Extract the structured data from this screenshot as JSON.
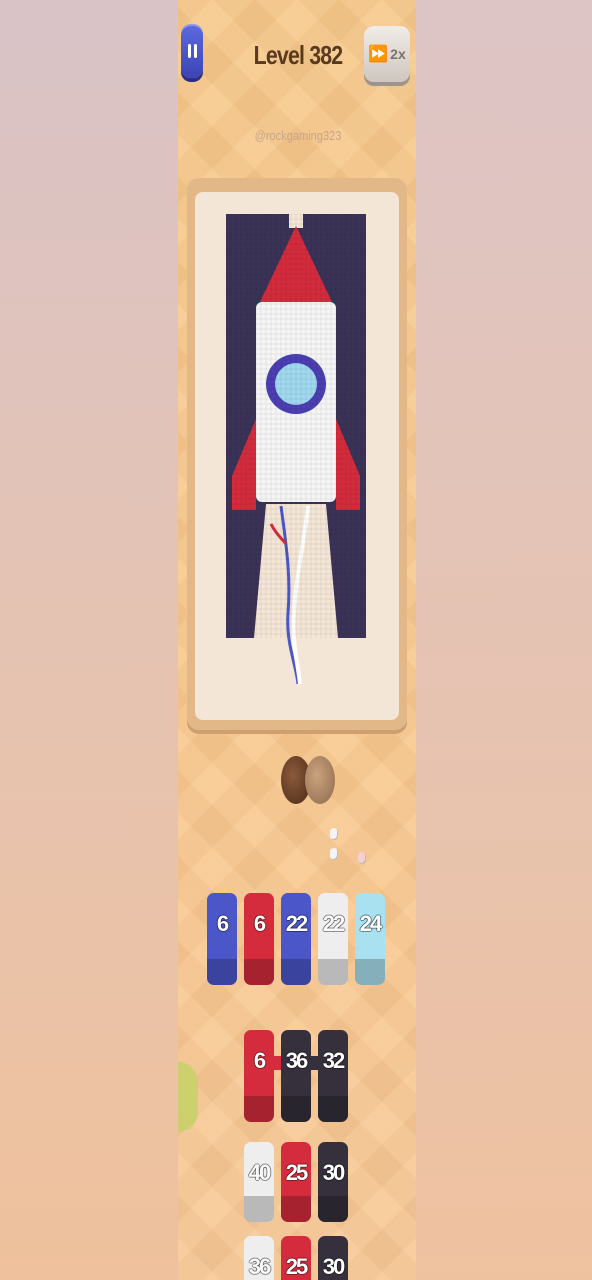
{
  "top_bar": {
    "pause_icon": "pause-icon",
    "level_title": "Level 382",
    "speed_icon": "fast-forward-icon",
    "speed_label": "2x"
  },
  "handle": "@rockgaming323",
  "colors": {
    "navy": "#3b3357",
    "red": "#d42c3c",
    "white": "#f5f5f5",
    "blue": "#4b57c9",
    "light_blue": "#a9e1f0",
    "dark": "#35303c"
  },
  "queue": [
    {
      "value": "6",
      "color": "blue"
    },
    {
      "value": "6",
      "color": "red"
    },
    {
      "value": "22",
      "color": "blue"
    },
    {
      "value": "22",
      "color": "white"
    },
    {
      "value": "24",
      "color": "light"
    }
  ],
  "grid": [
    {
      "value": "6",
      "color": "red"
    },
    {
      "value": "36",
      "color": "dark"
    },
    {
      "value": "32",
      "color": "dark"
    },
    {
      "value": "40",
      "color": "white"
    },
    {
      "value": "25",
      "color": "red"
    },
    {
      "value": "30",
      "color": "dark"
    },
    {
      "value": "36",
      "color": "white"
    },
    {
      "value": "25",
      "color": "red"
    },
    {
      "value": "30",
      "color": "dark"
    }
  ]
}
